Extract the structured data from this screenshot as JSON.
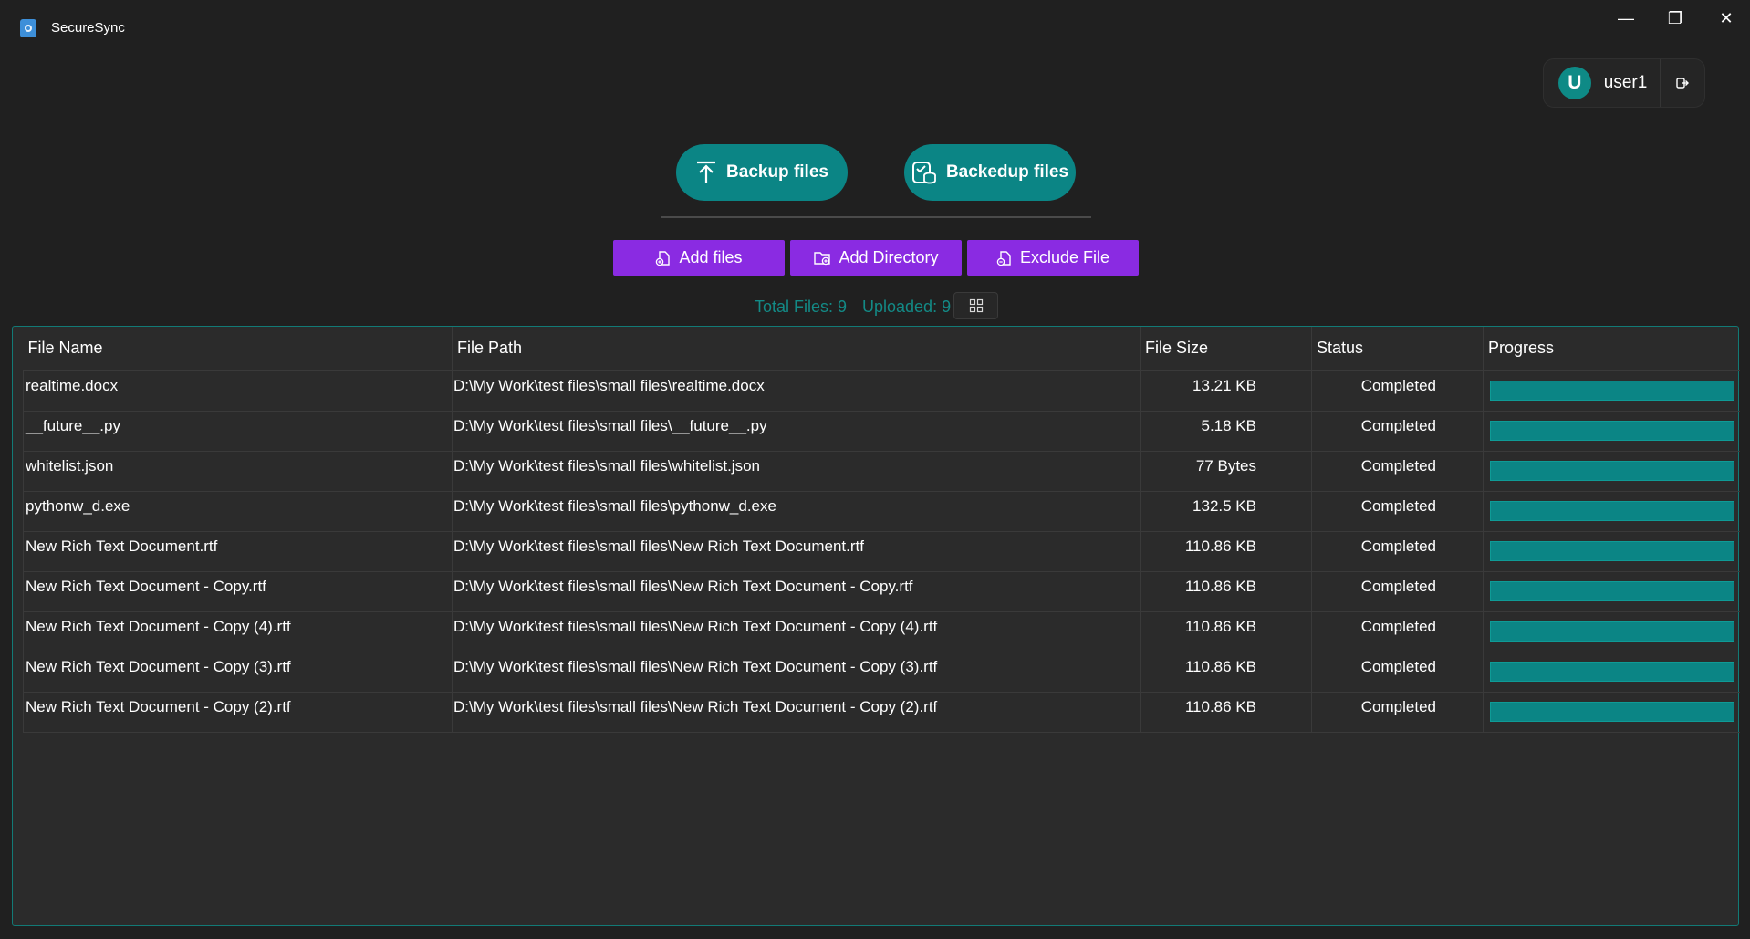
{
  "window": {
    "title": "SecureSync",
    "controls": {
      "minimize": "—",
      "maximize": "❐",
      "close": "✕"
    }
  },
  "user": {
    "avatar_letter": "U",
    "name": "user1"
  },
  "actions": {
    "backup_label": "Backup files",
    "backedup_label": "Backedup files"
  },
  "toolbar": {
    "add_files": "Add files",
    "add_directory": "Add Directory",
    "exclude_file": "Exclude File"
  },
  "stats": {
    "total": "Total Files: 9",
    "uploaded": "Uploaded: 9"
  },
  "colors": {
    "accent": "#0b8585",
    "purple": "#8a2be2",
    "bg": "#202020"
  },
  "table": {
    "columns": [
      "File Name",
      "File Path",
      "File Size",
      "Status",
      "Progress"
    ],
    "rows": [
      {
        "name": "realtime.docx",
        "path": "D:\\My Work\\test files\\small files\\realtime.docx",
        "size": "13.21 KB",
        "status": "Completed",
        "progress": 1.0
      },
      {
        "name": "__future__.py",
        "path": "D:\\My Work\\test files\\small files\\__future__.py",
        "size": "5.18 KB",
        "status": "Completed",
        "progress": 1.0
      },
      {
        "name": "whitelist.json",
        "path": "D:\\My Work\\test files\\small files\\whitelist.json",
        "size": "77 Bytes",
        "status": "Completed",
        "progress": 1.0
      },
      {
        "name": "pythonw_d.exe",
        "path": "D:\\My Work\\test files\\small files\\pythonw_d.exe",
        "size": "132.5 KB",
        "status": "Completed",
        "progress": 1.0
      },
      {
        "name": "New Rich Text Document.rtf",
        "path": "D:\\My Work\\test files\\small files\\New Rich Text Document.rtf",
        "size": "110.86 KB",
        "status": "Completed",
        "progress": 1.0
      },
      {
        "name": "New Rich Text Document - Copy.rtf",
        "path": "D:\\My Work\\test files\\small files\\New Rich Text Document - Copy.rtf",
        "size": "110.86 KB",
        "status": "Completed",
        "progress": 1.0
      },
      {
        "name": "New Rich Text Document - Copy (4).rtf",
        "path": "D:\\My Work\\test files\\small files\\New Rich Text Document - Copy (4).rtf",
        "size": "110.86 KB",
        "status": "Completed",
        "progress": 1.0
      },
      {
        "name": "New Rich Text Document - Copy (3).rtf",
        "path": "D:\\My Work\\test files\\small files\\New Rich Text Document - Copy (3).rtf",
        "size": "110.86 KB",
        "status": "Completed",
        "progress": 1.0
      },
      {
        "name": "New Rich Text Document - Copy (2).rtf",
        "path": "D:\\My Work\\test files\\small files\\New Rich Text Document - Copy (2).rtf",
        "size": "110.86 KB",
        "status": "Completed",
        "progress": 1.0
      }
    ]
  }
}
